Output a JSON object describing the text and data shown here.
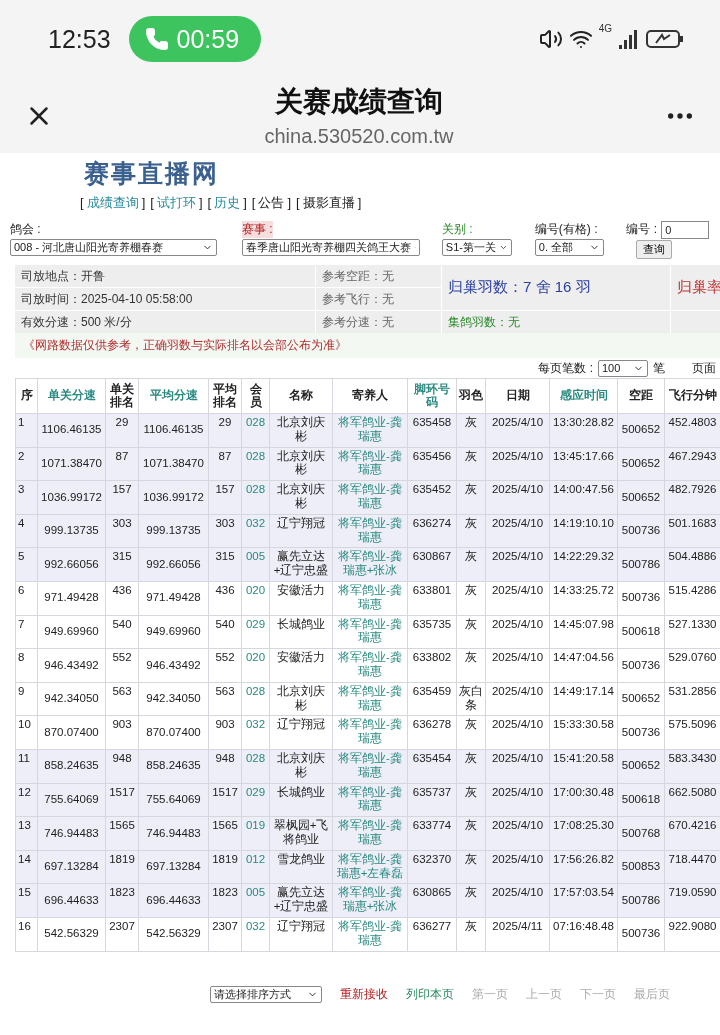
{
  "status_bar": {
    "time": "12:53",
    "call_timer": "00:59",
    "network": "4G"
  },
  "header": {
    "title": "关赛成绩查询",
    "url": "china.530520.com.tw"
  },
  "site": {
    "logo": "赛事直播网",
    "nav": [
      {
        "open": "[",
        "label": "成绩查询",
        "close": "]",
        "kind": "link"
      },
      {
        "open": "[",
        "label": "试打环",
        "close": "]",
        "kind": "link"
      },
      {
        "open": "[",
        "label": "历史",
        "close": "]",
        "kind": "link"
      },
      {
        "open": "[",
        "label": "公告",
        "close": "]",
        "kind": "plain"
      },
      {
        "open": "[",
        "label": "摄影直播",
        "close": "]",
        "kind": "plain"
      }
    ]
  },
  "filters": [
    {
      "label": "鸽会 :",
      "highlighted": false,
      "confirmed": false,
      "kind": "select",
      "value": "008 - 河北唐山阳光寄养棚春赛"
    },
    {
      "label": "赛事 :",
      "highlighted": true,
      "confirmed": false,
      "kind": "select",
      "value": "春季唐山阳光寄养棚四关鸽王大赛"
    },
    {
      "label": "关别 :",
      "highlighted": false,
      "confirmed": true,
      "kind": "select",
      "value": "S1-第一关"
    },
    {
      "label": "编号(有格) :",
      "highlighted": false,
      "confirmed": false,
      "kind": "select",
      "value": "0. 全部"
    },
    {
      "label": "编号 :",
      "highlighted": false,
      "confirmed": false,
      "kind": "input",
      "value": "0",
      "button": "查询"
    }
  ],
  "info": {
    "release_place": {
      "label": "司放地点：",
      "value": "开鲁"
    },
    "release_time": {
      "label": "司放时间：",
      "value": "2025-04-10 05:58:00"
    },
    "valid_speed": {
      "label": "有效分速：",
      "value": "500 米/分"
    },
    "ref_distance": {
      "label": "参考空距：",
      "value": "无"
    },
    "ref_flight": {
      "label": "参考飞行：",
      "value": "无"
    },
    "ref_speed": {
      "label": "参考分速：",
      "value": "无"
    },
    "returned": "归巢羽数：7 舍 16 羽",
    "return_rate": "归巢率",
    "collected": "集鸽羽数：无",
    "notice": "《网路数据仅供参考，正确羽数与实际排名以会部公布为准》"
  },
  "paging": {
    "label": "每页笔数 :",
    "value": "100",
    "unit": "笔",
    "page_label": "页面"
  },
  "table": {
    "columns": [
      {
        "label": "序",
        "sortable": false
      },
      {
        "label": "单关分速",
        "sortable": true
      },
      {
        "label": "单关排名",
        "sortable": false
      },
      {
        "label": "平均分速",
        "sortable": true
      },
      {
        "label": "平均排名",
        "sortable": false
      },
      {
        "label": "会员",
        "sortable": false
      },
      {
        "label": "名称",
        "sortable": false
      },
      {
        "label": "寄养人",
        "sortable": false
      },
      {
        "label": "脚环号码",
        "sortable": true
      },
      {
        "label": "羽色",
        "sortable": false
      },
      {
        "label": "日期",
        "sortable": false
      },
      {
        "label": "感应时间",
        "sortable": true
      },
      {
        "label": "空距",
        "sortable": false
      },
      {
        "label": "飞行分钟",
        "sortable": false
      }
    ],
    "rows": [
      {
        "shaded": true,
        "cells": [
          "1",
          "1106.46135",
          "29",
          "1106.46135",
          "29",
          "028",
          "北京刘庆彬",
          "将军鸽业-龚瑞惠",
          "635458",
          "灰",
          "2025/4/10",
          "13:30:28.82",
          "500652",
          "452.4803"
        ]
      },
      {
        "shaded": true,
        "cells": [
          "2",
          "1071.38470",
          "87",
          "1071.38470",
          "87",
          "028",
          "北京刘庆彬",
          "将军鸽业-龚瑞惠",
          "635456",
          "灰",
          "2025/4/10",
          "13:45:17.66",
          "500652",
          "467.2943"
        ]
      },
      {
        "shaded": true,
        "cells": [
          "3",
          "1036.99172",
          "157",
          "1036.99172",
          "157",
          "028",
          "北京刘庆彬",
          "将军鸽业-龚瑞惠",
          "635452",
          "灰",
          "2025/4/10",
          "14:00:47.56",
          "500652",
          "482.7926"
        ]
      },
      {
        "shaded": true,
        "cells": [
          "4",
          "999.13735",
          "303",
          "999.13735",
          "303",
          "032",
          "辽宁翔冠",
          "将军鸽业-龚瑞惠",
          "636274",
          "灰",
          "2025/4/10",
          "14:19:10.10",
          "500736",
          "501.1683"
        ]
      },
      {
        "shaded": true,
        "cells": [
          "5",
          "992.66056",
          "315",
          "992.66056",
          "315",
          "005",
          "赢先立达+辽宁忠盛",
          "将军鸽业-龚瑞惠+张冰",
          "630867",
          "灰",
          "2025/4/10",
          "14:22:29.32",
          "500786",
          "504.4886"
        ]
      },
      {
        "shaded": false,
        "cells": [
          "6",
          "971.49428",
          "436",
          "971.49428",
          "436",
          "020",
          "安徽活力",
          "将军鸽业-龚瑞惠",
          "633801",
          "灰",
          "2025/4/10",
          "14:33:25.72",
          "500736",
          "515.4286"
        ]
      },
      {
        "shaded": false,
        "cells": [
          "7",
          "949.69960",
          "540",
          "949.69960",
          "540",
          "029",
          "长城鸽业",
          "将军鸽业-龚瑞惠",
          "635735",
          "灰",
          "2025/4/10",
          "14:45:07.98",
          "500618",
          "527.1330"
        ]
      },
      {
        "shaded": false,
        "cells": [
          "8",
          "946.43492",
          "552",
          "946.43492",
          "552",
          "020",
          "安徽活力",
          "将军鸽业-龚瑞惠",
          "633802",
          "灰",
          "2025/4/10",
          "14:47:04.56",
          "500736",
          "529.0760"
        ]
      },
      {
        "shaded": false,
        "cells": [
          "9",
          "942.34050",
          "563",
          "942.34050",
          "563",
          "028",
          "北京刘庆彬",
          "将军鸽业-龚瑞惠",
          "635459",
          "灰白条",
          "2025/4/10",
          "14:49:17.14",
          "500652",
          "531.2856"
        ]
      },
      {
        "shaded": false,
        "cells": [
          "10",
          "870.07400",
          "903",
          "870.07400",
          "903",
          "032",
          "辽宁翔冠",
          "将军鸽业-龚瑞惠",
          "636278",
          "灰",
          "2025/4/10",
          "15:33:30.58",
          "500736",
          "575.5096"
        ]
      },
      {
        "shaded": true,
        "cells": [
          "11",
          "858.24635",
          "948",
          "858.24635",
          "948",
          "028",
          "北京刘庆彬",
          "将军鸽业-龚瑞惠",
          "635454",
          "灰",
          "2025/4/10",
          "15:41:20.58",
          "500652",
          "583.3430"
        ]
      },
      {
        "shaded": true,
        "cells": [
          "12",
          "755.64069",
          "1517",
          "755.64069",
          "1517",
          "029",
          "长城鸽业",
          "将军鸽业-龚瑞惠",
          "635737",
          "灰",
          "2025/4/10",
          "17:00:30.48",
          "500618",
          "662.5080"
        ]
      },
      {
        "shaded": true,
        "cells": [
          "13",
          "746.94483",
          "1565",
          "746.94483",
          "1565",
          "019",
          "翠枫园+飞将鸽业",
          "将军鸽业-龚瑞惠",
          "633774",
          "灰",
          "2025/4/10",
          "17:08:25.30",
          "500768",
          "670.4216"
        ]
      },
      {
        "shaded": true,
        "cells": [
          "14",
          "697.13284",
          "1819",
          "697.13284",
          "1819",
          "012",
          "雪龙鸽业",
          "将军鸽业-龚瑞惠+左春磊",
          "632370",
          "灰",
          "2025/4/10",
          "17:56:26.82",
          "500853",
          "718.4470"
        ]
      },
      {
        "shaded": true,
        "cells": [
          "15",
          "696.44633",
          "1823",
          "696.44633",
          "1823",
          "005",
          "赢先立达+辽宁忠盛",
          "将军鸽业-龚瑞惠+张冰",
          "630865",
          "灰",
          "2025/4/10",
          "17:57:03.54",
          "500786",
          "719.0590"
        ]
      },
      {
        "shaded": false,
        "cells": [
          "16",
          "542.56329",
          "2307",
          "542.56329",
          "2307",
          "032",
          "辽宁翔冠",
          "将军鸽业-龚瑞惠",
          "636277",
          "灰",
          "2025/4/11",
          "07:16:48.48",
          "500736",
          "922.9080"
        ]
      }
    ]
  },
  "footer": {
    "sort_select": "请选择排序方式",
    "actions": [
      {
        "label": "重新接收",
        "kind": "reload",
        "disabled": false
      },
      {
        "label": "列印本页",
        "kind": "print",
        "disabled": false
      },
      {
        "label": "第一页",
        "kind": "page",
        "disabled": true
      },
      {
        "label": "上一页",
        "kind": "page",
        "disabled": true
      },
      {
        "label": "下一页",
        "kind": "page",
        "disabled": true
      },
      {
        "label": "最后页",
        "kind": "page",
        "disabled": true
      }
    ]
  }
}
